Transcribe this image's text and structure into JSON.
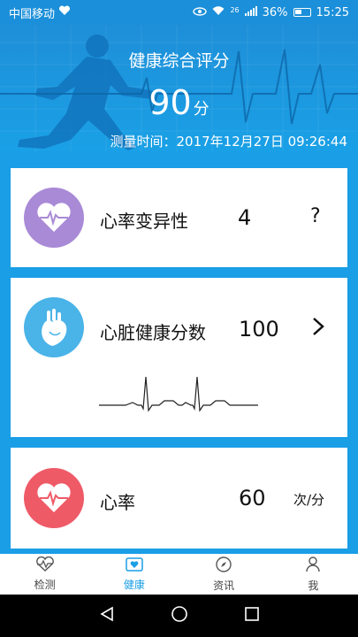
{
  "status_bar": {
    "carrier": "中国移动",
    "network": "26",
    "battery": "36%",
    "time": "15:25"
  },
  "header": {
    "title": "健康综合评分",
    "score": "90",
    "score_unit": "分",
    "measure_time": "测量时间：2017年12月27日 09:26:44"
  },
  "cards": [
    {
      "label": "心率变异性",
      "value": "4",
      "action": "?",
      "icon": "heart-pulse-icon",
      "color": "#a98ad6"
    },
    {
      "label": "心脏健康分数",
      "value": "100",
      "action": "chevron-right",
      "icon": "anatomical-heart-icon",
      "color": "#4ab3e8"
    },
    {
      "label": "心率",
      "value": "60",
      "unit": "次/分",
      "icon": "heart-rate-icon",
      "color": "#ef5a67"
    }
  ],
  "bottom_nav": [
    {
      "label": "检测",
      "icon": "heart-monitor-icon",
      "active": false
    },
    {
      "label": "健康",
      "icon": "health-tab-icon",
      "active": true
    },
    {
      "label": "资讯",
      "icon": "compass-icon",
      "active": false
    },
    {
      "label": "我",
      "icon": "person-icon",
      "active": false
    }
  ]
}
